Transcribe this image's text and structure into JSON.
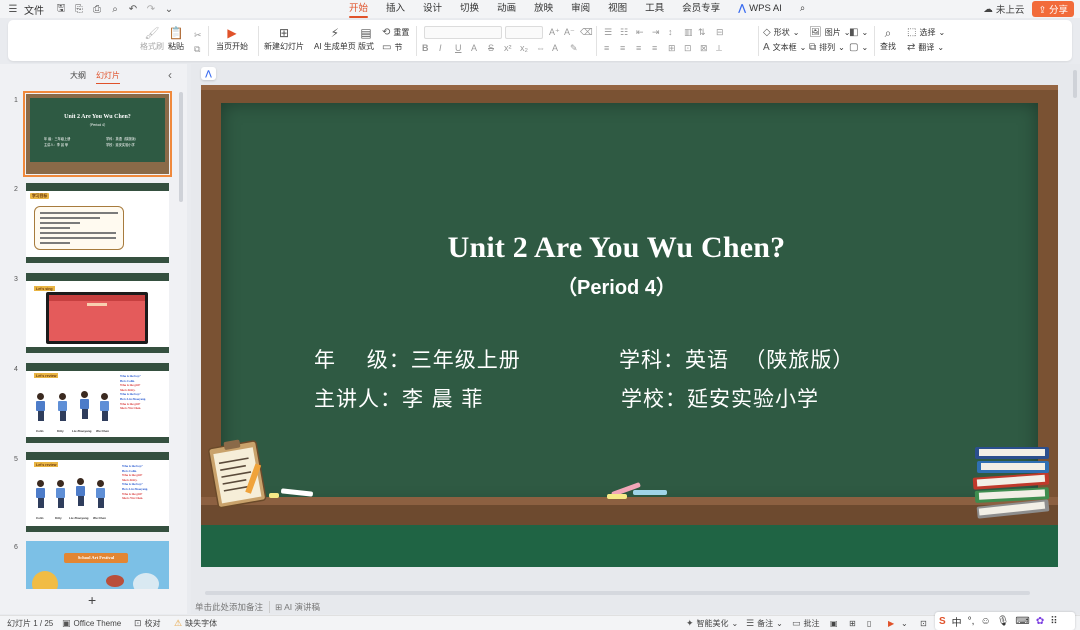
{
  "menubar": {
    "file_label": "文件",
    "tabs": [
      "开始",
      "插入",
      "设计",
      "切换",
      "动画",
      "放映",
      "审阅",
      "视图",
      "工具",
      "会员专享"
    ],
    "active_tab": "开始",
    "wps_ai": "WPS AI",
    "cloud_status": "未上云",
    "share": "分享"
  },
  "ribbon": {
    "format_painter": "格式刷",
    "paste": "粘贴",
    "play_current": "当页开始",
    "new_slide": "新建幻灯片",
    "ai_generate": "AI 生成单页",
    "layout": "版式",
    "section": "节",
    "reset": "重置",
    "shape": "形状",
    "picture": "图片",
    "fill": "填充",
    "select": "选择",
    "textbox": "文本框",
    "arrange": "排列",
    "outline": "轮廓",
    "find": "查找",
    "replace": "翻译"
  },
  "left_panel": {
    "tab_outline": "大纲",
    "tab_slides": "幻灯片",
    "thumb_numbers": [
      "1",
      "2",
      "3",
      "4",
      "5",
      "6"
    ],
    "thumb1": {
      "title": "Unit 2  Are You Wu Chen?",
      "sub": "（Period 4）",
      "l1": "年    级：三年级上册",
      "l2": "学科：英语（陕旅版）",
      "l3": "主讲人：李 晨 菲",
      "l4": "学校：延安实验小学"
    },
    "thumb2_badge": "学习目标",
    "thumb3_badge": "Let's sing",
    "thumb4_badge": "Let's review",
    "thumb4_names": [
      "Colin",
      "Kitty",
      "Liu Zhaoyang",
      "Wu Chen"
    ],
    "thumb4_lines": [
      "Who is the boy?",
      "He is Colin.",
      "Who is the girl?",
      "She is Kitty.",
      "Who is the boy?",
      "He is Liu Zhaoyang.",
      "Who is the girl?",
      "She is Wu Chen."
    ],
    "thumb5_badge": "Let's review",
    "thumb6_banner": "School Art Festival"
  },
  "slide": {
    "title": "Unit 2  Are You Wu Chen?",
    "subtitle": "（Period 4）",
    "grade": "年    级：三年级上册",
    "subject": "学科：英语  （陕旅版）",
    "speaker": "主讲人：李 晨 菲",
    "school": "学校：延安实验小学"
  },
  "notes": {
    "placeholder": "单击此处添加备注",
    "ai_notes": "AI 演讲稿"
  },
  "status": {
    "slide_counter": "幻灯片 1 / 25",
    "theme": "Office Theme",
    "proofread": "校对",
    "missing_font": "缺失字体",
    "smart_beautify": "智能美化",
    "notes": "备注",
    "comments": "批注"
  },
  "ime": {
    "lang": "中"
  },
  "colors": {
    "accent": "#e0522a",
    "share": "#f26b3a",
    "board": "#2f5a43",
    "frame": "#7a5233",
    "floor": "#1f6444"
  }
}
